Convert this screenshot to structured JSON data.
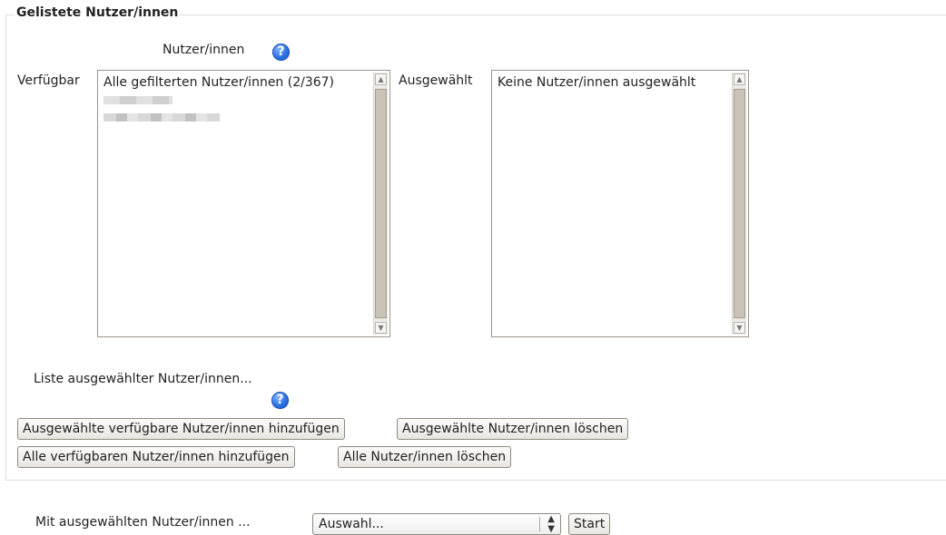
{
  "fieldset": {
    "legend": "Gelistete Nutzer/innen"
  },
  "users_label": "Nutzer/innen",
  "available": {
    "label": "Verfügbar",
    "items": [
      {
        "text": "Alle gefilterten Nutzer/innen (2/367)"
      }
    ]
  },
  "selected": {
    "label": "Ausgewählt",
    "items": [
      {
        "text": "Keine Nutzer/innen ausgewählt"
      }
    ]
  },
  "list_label": "Liste ausgewählter Nutzer/innen...",
  "buttons": {
    "add_selected": "Ausgewählte verfügbare Nutzer/innen hinzufügen",
    "remove_selected": "Ausgewählte Nutzer/innen löschen",
    "add_all": "Alle verfügbaren Nutzer/innen hinzufügen",
    "remove_all": "Alle Nutzer/innen löschen"
  },
  "bulk_action": {
    "label": "Mit ausgewählten Nutzer/innen ...",
    "select_value": "Auswahl...",
    "go_button": "Start"
  },
  "icons": {
    "help": "help-icon"
  }
}
